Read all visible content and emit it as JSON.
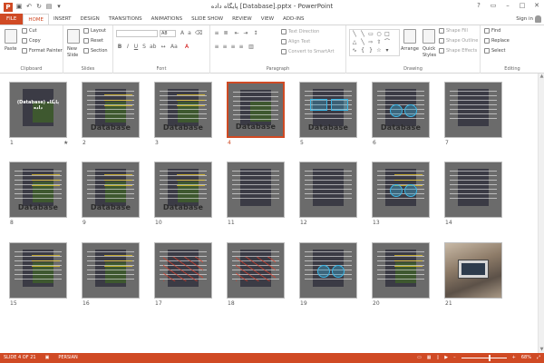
{
  "window": {
    "title": "پایگاه داده [Database].pptx - PowerPoint",
    "logo": "P",
    "qat": [
      "save-icon",
      "undo-icon",
      "redo-icon",
      "slideshow-icon",
      "customize-icon"
    ],
    "controls": [
      "?",
      "▭",
      "–",
      "□",
      "✕"
    ]
  },
  "tabs": [
    {
      "label": "FILE",
      "kind": "file"
    },
    {
      "label": "HOME",
      "kind": "active"
    },
    {
      "label": "INSERT"
    },
    {
      "label": "DESIGN"
    },
    {
      "label": "TRANSITIONS"
    },
    {
      "label": "ANIMATIONS"
    },
    {
      "label": "SLIDE SHOW"
    },
    {
      "label": "REVIEW"
    },
    {
      "label": "VIEW"
    },
    {
      "label": "ADD-INS"
    }
  ],
  "signin": "Sign in",
  "ribbon": {
    "clipboard": {
      "label": "Clipboard",
      "paste": "Paste",
      "cut": "Cut",
      "copy": "Copy",
      "format_painter": "Format Painter"
    },
    "slides": {
      "label": "Slides",
      "new_slide": "New",
      "new_slide2": "Slide",
      "layout": "Layout",
      "reset": "Reset",
      "section": "Section"
    },
    "font": {
      "label": "Font",
      "size": "A8"
    },
    "paragraph": {
      "label": "Paragraph",
      "text_direction": "Text Direction",
      "align_text": "Align Text",
      "smartart": "Convert to SmartArt"
    },
    "drawing": {
      "label": "Drawing",
      "arrange": "Arrange",
      "quick": "Quick",
      "styles": "Styles",
      "shape_fill": "Shape Fill",
      "shape_outline": "Shape Outline",
      "shape_effects": "Shape Effects"
    },
    "editing": {
      "label": "Editing",
      "find": "Find",
      "replace": "Replace",
      "select": "Select"
    }
  },
  "slides": [
    {
      "num": "1",
      "style": "title",
      "label": "(Database) پایگاه داده",
      "star": "★"
    },
    {
      "num": "2",
      "style": "db",
      "db": "Database"
    },
    {
      "num": "3",
      "style": "db",
      "db": "Database"
    },
    {
      "num": "4",
      "style": "text-db",
      "db": "Database",
      "selected": true
    },
    {
      "num": "5",
      "style": "blue",
      "db": "Database"
    },
    {
      "num": "6",
      "style": "circles",
      "db": "Database"
    },
    {
      "num": "7",
      "style": "text"
    },
    {
      "num": "8",
      "style": "db",
      "db": "Database"
    },
    {
      "num": "9",
      "style": "db",
      "db": "Database"
    },
    {
      "num": "10",
      "style": "db",
      "db": "Database"
    },
    {
      "num": "11",
      "style": "text"
    },
    {
      "num": "12",
      "style": "text"
    },
    {
      "num": "13",
      "style": "text-ok"
    },
    {
      "num": "14",
      "style": "text"
    },
    {
      "num": "15",
      "style": "db"
    },
    {
      "num": "16",
      "style": "db"
    },
    {
      "num": "17",
      "style": "red"
    },
    {
      "num": "18",
      "style": "red"
    },
    {
      "num": "19",
      "style": "circles"
    },
    {
      "num": "20",
      "style": "db"
    },
    {
      "num": "21",
      "style": "photo"
    }
  ],
  "status": {
    "slide_of": "SLIDE 4 OF 21",
    "language": "PERSIAN",
    "zoom": "68%"
  },
  "colors": {
    "accent": "#d04a24",
    "selected_border": "#d04a24"
  }
}
